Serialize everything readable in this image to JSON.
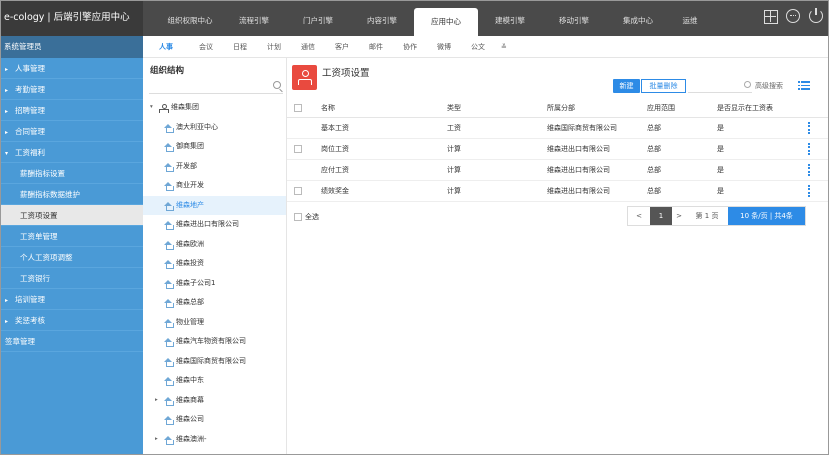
{
  "app": {
    "title": "e-cology | 后端引擎应用中心"
  },
  "topnav": {
    "items": [
      {
        "label": "组织权限中心"
      },
      {
        "label": "流程引擎"
      },
      {
        "label": "门户引擎"
      },
      {
        "label": "内容引擎"
      },
      {
        "label": "应用中心",
        "active": true
      },
      {
        "label": "建模引擎"
      },
      {
        "label": "移动引擎"
      },
      {
        "label": "集成中心"
      },
      {
        "label": "运维"
      }
    ],
    "icons": [
      "grid-icon",
      "more-icon",
      "power-icon"
    ]
  },
  "sidebar": {
    "header": "系统管理员",
    "items": [
      {
        "label": "人事管理",
        "level": 1,
        "expanded": false
      },
      {
        "label": "考勤管理",
        "level": 1,
        "expanded": false
      },
      {
        "label": "招聘管理",
        "level": 1,
        "expanded": false
      },
      {
        "label": "合同管理",
        "level": 1,
        "expanded": false
      },
      {
        "label": "工资福利",
        "level": 1,
        "expanded": true
      },
      {
        "label": "薪酬指标设置",
        "level": 2
      },
      {
        "label": "薪酬指标数据维护",
        "level": 2
      },
      {
        "label": "工资项设置",
        "level": 2,
        "active": true
      },
      {
        "label": "工资单管理",
        "level": 2
      },
      {
        "label": "个人工资项调整",
        "level": 2
      },
      {
        "label": "工资银行",
        "level": 2
      },
      {
        "label": "培训管理",
        "level": 1,
        "expanded": false
      },
      {
        "label": "奖惩考核",
        "level": 1,
        "expanded": false
      },
      {
        "label": "签章管理",
        "level": 1,
        "noarrow": true
      }
    ]
  },
  "subnav": {
    "items": [
      {
        "label": "人事",
        "active": true
      },
      {
        "label": "会议"
      },
      {
        "label": "日程"
      },
      {
        "label": "计划"
      },
      {
        "label": "通信"
      },
      {
        "label": "客户"
      },
      {
        "label": "邮件"
      },
      {
        "label": "协作"
      },
      {
        "label": "微博"
      },
      {
        "label": "公文"
      }
    ]
  },
  "org": {
    "title": "组织结构",
    "tree": [
      {
        "label": "维森集团",
        "depth": 0,
        "toggle": "▾",
        "icon": "org"
      },
      {
        "label": "澳大利亚中心",
        "depth": 1
      },
      {
        "label": "御商集团",
        "depth": 1
      },
      {
        "label": "开发部",
        "depth": 1
      },
      {
        "label": "商业开发",
        "depth": 1
      },
      {
        "label": "维森地产",
        "depth": 1,
        "selected": true
      },
      {
        "label": "维森进出口有限公司",
        "depth": 1
      },
      {
        "label": "维森欧洲",
        "depth": 1
      },
      {
        "label": "维森投资",
        "depth": 1
      },
      {
        "label": "维森子公司1",
        "depth": 1
      },
      {
        "label": "维森总部",
        "depth": 1
      },
      {
        "label": "物业管理",
        "depth": 1
      },
      {
        "label": "维森汽车物资有限公司",
        "depth": 1
      },
      {
        "label": "维森国际商贸有限公司",
        "depth": 1
      },
      {
        "label": "维森中东",
        "depth": 1
      },
      {
        "label": "维森商幕",
        "depth": 1,
        "toggle": "▸"
      },
      {
        "label": "维森公司",
        "depth": 1
      },
      {
        "label": "维森澳洲-",
        "depth": 1,
        "toggle": "▸"
      }
    ]
  },
  "main": {
    "title": "工资项设置",
    "new_label": "新建",
    "batch_delete_label": "批量删除",
    "search_placeholder": "",
    "advanced_label": "高级搜索",
    "columns": [
      "名称",
      "类型",
      "所属分部",
      "应用范围",
      "是否显示在工资表"
    ],
    "rows": [
      [
        "基本工资",
        "工资",
        "维森国际商贸有限公司",
        "总部",
        "是"
      ],
      [
        "岗位工资",
        "计算",
        "维森进出口有限公司",
        "总部",
        "是"
      ],
      [
        "应付工资",
        "计算",
        "维森进出口有限公司",
        "总部",
        "是"
      ],
      [
        "绩效奖金",
        "计算",
        "维森进出口有限公司",
        "总部",
        "是"
      ]
    ],
    "row_checkbox": [
      false,
      true,
      false,
      true
    ],
    "select_all_label": "全选",
    "pager": {
      "prev": "<",
      "current": "1",
      "next": ">",
      "jump": "第 1 页",
      "size": "10 条/页 | 共4条"
    }
  }
}
